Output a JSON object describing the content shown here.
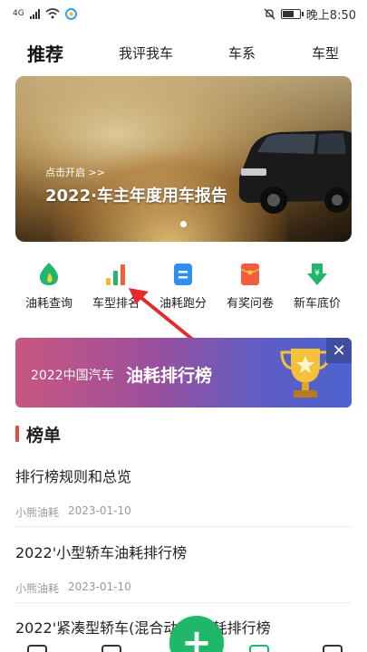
{
  "status_bar": {
    "signal_text": "4G",
    "time": "晚上8:50"
  },
  "nav": {
    "tabs": [
      "推荐",
      "我评我车",
      "车系",
      "车型"
    ]
  },
  "banner": {
    "subtitle": "点击开启 >>",
    "title": "2022·车主年度用车报告"
  },
  "quick_links": [
    {
      "label": "油耗查询",
      "icon": "drop-icon",
      "color": "#1fb86a"
    },
    {
      "label": "车型排名",
      "icon": "bar-chart-icon",
      "color": "#1fb86a"
    },
    {
      "label": "油耗跑分",
      "icon": "document-icon",
      "color": "#2e8ff0"
    },
    {
      "label": "有奖问卷",
      "icon": "red-envelope-icon",
      "color": "#f05c3c"
    },
    {
      "label": "新车底价",
      "icon": "price-down-icon",
      "color": "#1fb86a"
    }
  ],
  "promo": {
    "year_text": "2022中国汽车",
    "title": "油耗排行榜",
    "close_label": "✕"
  },
  "section": {
    "title": "榜单"
  },
  "articles": [
    {
      "title": "排行榜规则和总览",
      "source": "小熊油耗",
      "date": "2023-01-10"
    },
    {
      "title": "2022'小型轿车油耗排行榜",
      "source": "小熊油耗",
      "date": "2023-01-10"
    },
    {
      "title": "2022'紧凑型轿车(混合动力)油耗排行榜",
      "source": "",
      "date": ""
    }
  ],
  "fab": {
    "label": "+"
  }
}
